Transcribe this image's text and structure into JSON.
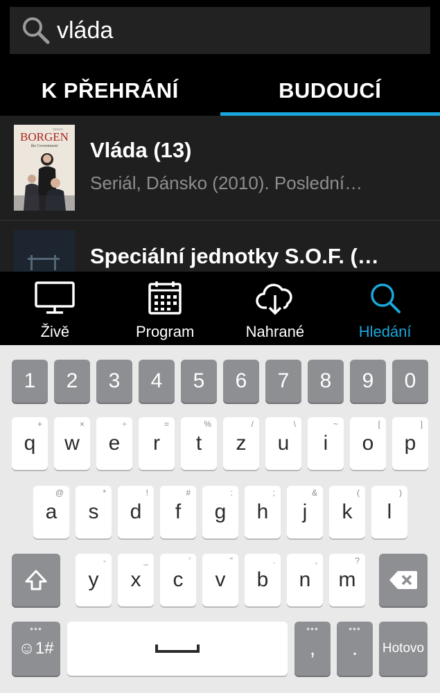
{
  "search": {
    "value": "vláda"
  },
  "tabs": [
    {
      "label": "K PŘEHRÁNÍ",
      "active": false
    },
    {
      "label": "BUDOUCÍ",
      "active": true
    }
  ],
  "results": [
    {
      "title": "Vláda (13)",
      "subtitle": "Seriál, Dánsko (2010). Poslední…",
      "poster_text": "BORGEN",
      "poster_sub": "the Government",
      "poster_top": "SERIES"
    },
    {
      "title": "Speciální jednotky S.O.F. (…",
      "subtitle": ""
    }
  ],
  "bottom_nav": [
    {
      "label": "Živě",
      "icon": "tv-icon",
      "active": false
    },
    {
      "label": "Program",
      "icon": "calendar-icon",
      "active": false
    },
    {
      "label": "Nahrané",
      "icon": "cloud-download-icon",
      "active": false
    },
    {
      "label": "Hledání",
      "icon": "search-icon",
      "active": true
    }
  ],
  "keyboard": {
    "row_numbers": [
      "1",
      "2",
      "3",
      "4",
      "5",
      "6",
      "7",
      "8",
      "9",
      "0"
    ],
    "row1": [
      {
        "k": "q",
        "h": "+"
      },
      {
        "k": "w",
        "h": "×"
      },
      {
        "k": "e",
        "h": "÷"
      },
      {
        "k": "r",
        "h": "="
      },
      {
        "k": "t",
        "h": "%"
      },
      {
        "k": "z",
        "h": "/"
      },
      {
        "k": "u",
        "h": "\\"
      },
      {
        "k": "i",
        "h": "~"
      },
      {
        "k": "o",
        "h": "["
      },
      {
        "k": "p",
        "h": "]"
      }
    ],
    "row2": [
      {
        "k": "a",
        "h": "@"
      },
      {
        "k": "s",
        "h": "*"
      },
      {
        "k": "d",
        "h": "!"
      },
      {
        "k": "f",
        "h": "#"
      },
      {
        "k": "g",
        "h": ":"
      },
      {
        "k": "h",
        "h": ";"
      },
      {
        "k": "j",
        "h": "&"
      },
      {
        "k": "k",
        "h": "("
      },
      {
        "k": "l",
        "h": ")"
      }
    ],
    "row3": [
      {
        "k": "y",
        "h": "-"
      },
      {
        "k": "x",
        "h": "_"
      },
      {
        "k": "c",
        "h": "'"
      },
      {
        "k": "v",
        "h": "\""
      },
      {
        "k": "b",
        "h": "."
      },
      {
        "k": "n",
        "h": ","
      },
      {
        "k": "m",
        "h": "?"
      }
    ],
    "symbols_label": "☺1#",
    "comma": ",",
    "period": ".",
    "done_label": "Hotovo"
  },
  "colors": {
    "accent": "#1aa7dc",
    "background": "#000000",
    "list_bg": "#1f1f20"
  }
}
